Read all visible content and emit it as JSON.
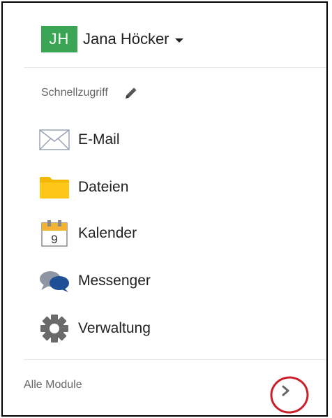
{
  "user": {
    "initials": "JH",
    "name": "Jana Höcker",
    "avatar_color": "#3aa655"
  },
  "quick_access": {
    "label": "Schnellzugriff",
    "edit_icon": "pencil-icon"
  },
  "menu": {
    "items": [
      {
        "label": "E-Mail",
        "icon": "mail-icon"
      },
      {
        "label": "Dateien",
        "icon": "folder-icon"
      },
      {
        "label": "Kalender",
        "icon": "calendar-icon",
        "icon_text": "9"
      },
      {
        "label": "Messenger",
        "icon": "chat-bubbles-icon"
      },
      {
        "label": "Verwaltung",
        "icon": "gear-icon"
      }
    ]
  },
  "all_modules": {
    "label": "Alle Module",
    "icon": "chevron-right-icon",
    "highlight_color": "#cc1f2a"
  }
}
